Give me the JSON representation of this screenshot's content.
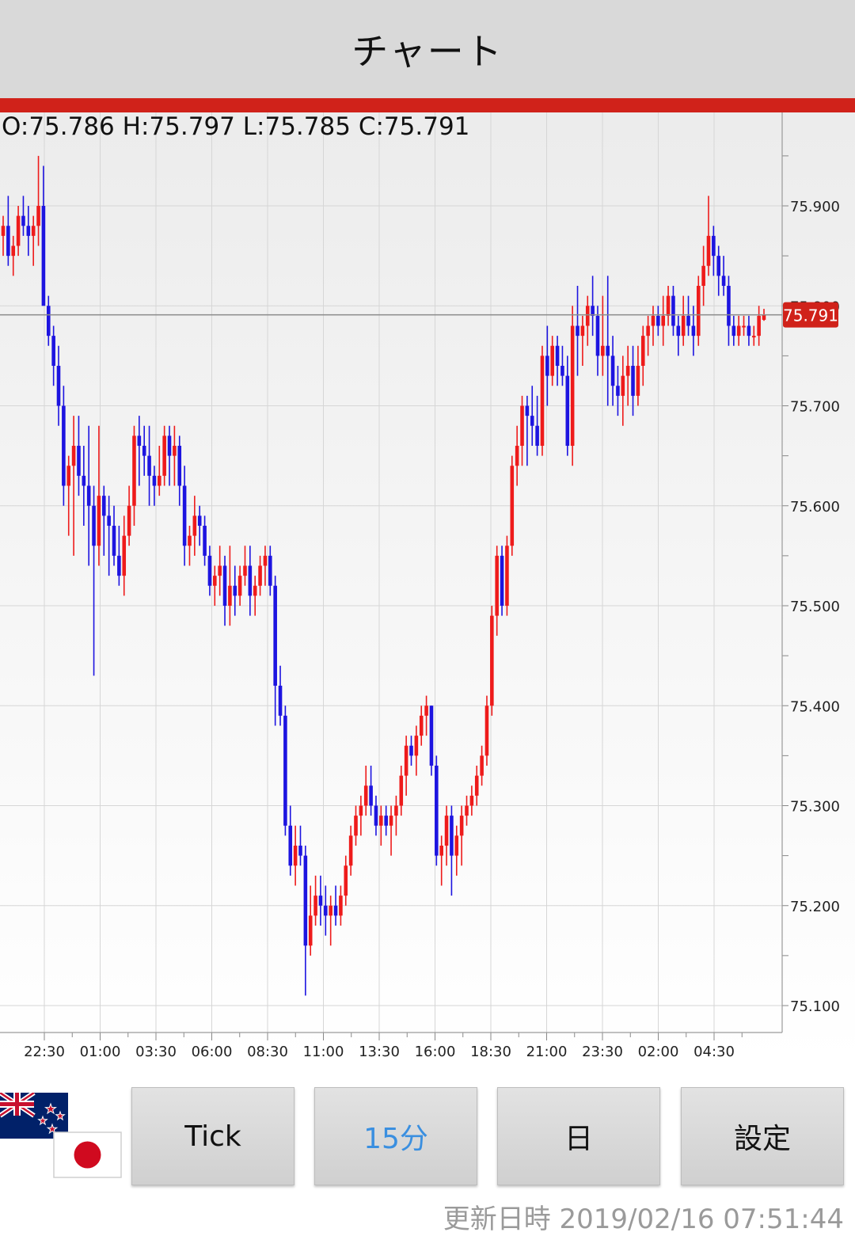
{
  "header": {
    "title": "チャート"
  },
  "ohlc": {
    "open_label": "O:",
    "open": "75.786",
    "high_label": "H:",
    "high": "75.797",
    "low_label": "L:",
    "low": "75.785",
    "close_label": "C:",
    "close": "75.791"
  },
  "colors": {
    "up": "#ee1b1b",
    "down": "#1d14e0",
    "accent": "#d0221a",
    "active_tab": "#3a8fe0"
  },
  "buttons": {
    "tick": "Tick",
    "min15": "15分",
    "day": "日",
    "settings": "設定"
  },
  "active_button": "min15",
  "flags": {
    "base": "new-zealand-flag-icon",
    "quote": "japan-flag-icon"
  },
  "status": {
    "updated_label": "更新日時",
    "updated_value": "2019/02/16 07:51:44"
  },
  "chart_data": {
    "type": "candlestick",
    "interval": "15分",
    "ylim": [
      75.08,
      75.99
    ],
    "y_ticks": [
      "75.900",
      "75.800",
      "75.700",
      "75.600",
      "75.500",
      "75.400",
      "75.300",
      "75.200",
      "75.100"
    ],
    "x_ticks": [
      "22:30",
      "01:00",
      "03:30",
      "06:00",
      "08:30",
      "11:00",
      "13:30",
      "16:00",
      "18:30",
      "21:00",
      "23:30",
      "02:00",
      "04:30"
    ],
    "current_price": "75.791",
    "grid": true,
    "series": [
      [
        75.87,
        75.89,
        75.85,
        75.88
      ],
      [
        75.88,
        75.91,
        75.84,
        75.85
      ],
      [
        75.85,
        75.87,
        75.83,
        75.86
      ],
      [
        75.86,
        75.9,
        75.85,
        75.89
      ],
      [
        75.89,
        75.91,
        75.87,
        75.88
      ],
      [
        75.88,
        75.9,
        75.85,
        75.87
      ],
      [
        75.87,
        75.89,
        75.84,
        75.88
      ],
      [
        75.88,
        75.95,
        75.86,
        75.9
      ],
      [
        75.9,
        75.94,
        75.86,
        75.8
      ],
      [
        75.8,
        75.81,
        75.76,
        75.77
      ],
      [
        75.77,
        75.78,
        75.72,
        75.74
      ],
      [
        75.74,
        75.76,
        75.68,
        75.7
      ],
      [
        75.7,
        75.72,
        75.6,
        75.62
      ],
      [
        75.62,
        75.65,
        75.57,
        75.64
      ],
      [
        75.64,
        75.69,
        75.55,
        75.66
      ],
      [
        75.66,
        75.69,
        75.61,
        75.63
      ],
      [
        75.63,
        75.66,
        75.58,
        75.62
      ],
      [
        75.62,
        75.68,
        75.54,
        75.6
      ],
      [
        75.6,
        75.62,
        75.43,
        75.56
      ],
      [
        75.56,
        75.68,
        75.54,
        75.61
      ],
      [
        75.61,
        75.62,
        75.55,
        75.59
      ],
      [
        75.59,
        75.61,
        75.53,
        75.58
      ],
      [
        75.58,
        75.6,
        75.54,
        75.55
      ],
      [
        75.55,
        75.58,
        75.52,
        75.53
      ],
      [
        75.53,
        75.59,
        75.51,
        75.57
      ],
      [
        75.57,
        75.62,
        75.56,
        75.6
      ],
      [
        75.6,
        75.68,
        75.58,
        75.67
      ],
      [
        75.67,
        75.69,
        75.62,
        75.66
      ],
      [
        75.66,
        75.68,
        75.63,
        75.65
      ],
      [
        75.65,
        75.68,
        75.6,
        75.63
      ],
      [
        75.63,
        75.64,
        75.6,
        75.62
      ],
      [
        75.62,
        75.66,
        75.61,
        75.63
      ],
      [
        75.63,
        75.68,
        75.62,
        75.67
      ],
      [
        75.67,
        75.68,
        75.62,
        75.65
      ],
      [
        75.65,
        75.68,
        75.62,
        75.66
      ],
      [
        75.66,
        75.67,
        75.6,
        75.62
      ],
      [
        75.62,
        75.64,
        75.54,
        75.56
      ],
      [
        75.56,
        75.58,
        75.54,
        75.57
      ],
      [
        75.57,
        75.61,
        75.55,
        75.59
      ],
      [
        75.59,
        75.6,
        75.56,
        75.58
      ],
      [
        75.58,
        75.59,
        75.54,
        75.55
      ],
      [
        75.55,
        75.56,
        75.51,
        75.52
      ],
      [
        75.52,
        75.54,
        75.5,
        75.53
      ],
      [
        75.53,
        75.56,
        75.51,
        75.54
      ],
      [
        75.54,
        75.55,
        75.48,
        75.5
      ],
      [
        75.5,
        75.56,
        75.48,
        75.52
      ],
      [
        75.52,
        75.54,
        75.49,
        75.51
      ],
      [
        75.51,
        75.54,
        75.5,
        75.53
      ],
      [
        75.53,
        75.56,
        75.52,
        75.54
      ],
      [
        75.54,
        75.56,
        75.49,
        75.51
      ],
      [
        75.51,
        75.53,
        75.49,
        75.52
      ],
      [
        75.52,
        75.55,
        75.51,
        75.54
      ],
      [
        75.54,
        75.56,
        75.52,
        75.55
      ],
      [
        75.55,
        75.56,
        75.51,
        75.52
      ],
      [
        75.52,
        75.53,
        75.38,
        75.42
      ],
      [
        75.42,
        75.44,
        75.38,
        75.39
      ],
      [
        75.39,
        75.4,
        75.27,
        75.28
      ],
      [
        75.28,
        75.3,
        75.23,
        75.24
      ],
      [
        75.24,
        75.28,
        75.22,
        75.26
      ],
      [
        75.26,
        75.28,
        75.24,
        75.25
      ],
      [
        75.25,
        75.26,
        75.11,
        75.16
      ],
      [
        75.16,
        75.22,
        75.15,
        75.19
      ],
      [
        75.19,
        75.23,
        75.18,
        75.21
      ],
      [
        75.21,
        75.23,
        75.18,
        75.2
      ],
      [
        75.2,
        75.22,
        75.17,
        75.19
      ],
      [
        75.19,
        75.21,
        75.16,
        75.2
      ],
      [
        75.2,
        75.22,
        75.18,
        75.19
      ],
      [
        75.19,
        75.22,
        75.18,
        75.21
      ],
      [
        75.21,
        75.25,
        75.2,
        75.24
      ],
      [
        75.24,
        75.28,
        75.23,
        75.27
      ],
      [
        75.27,
        75.3,
        75.26,
        75.29
      ],
      [
        75.29,
        75.31,
        75.27,
        75.3
      ],
      [
        75.3,
        75.34,
        75.29,
        75.32
      ],
      [
        75.32,
        75.34,
        75.29,
        75.3
      ],
      [
        75.3,
        75.31,
        75.27,
        75.28
      ],
      [
        75.28,
        75.3,
        75.26,
        75.29
      ],
      [
        75.29,
        75.3,
        75.27,
        75.28
      ],
      [
        75.28,
        75.3,
        75.25,
        75.29
      ],
      [
        75.29,
        75.31,
        75.27,
        75.3
      ],
      [
        75.3,
        75.34,
        75.29,
        75.33
      ],
      [
        75.33,
        75.37,
        75.31,
        75.36
      ],
      [
        75.36,
        75.37,
        75.34,
        75.35
      ],
      [
        75.35,
        75.38,
        75.33,
        75.37
      ],
      [
        75.37,
        75.4,
        75.36,
        75.39
      ],
      [
        75.39,
        75.41,
        75.37,
        75.4
      ],
      [
        75.4,
        75.4,
        75.33,
        75.34
      ],
      [
        75.34,
        75.35,
        75.24,
        75.25
      ],
      [
        75.25,
        75.27,
        75.22,
        75.26
      ],
      [
        75.26,
        75.3,
        75.24,
        75.29
      ],
      [
        75.29,
        75.3,
        75.21,
        75.25
      ],
      [
        75.25,
        75.28,
        75.23,
        75.27
      ],
      [
        75.27,
        75.3,
        75.24,
        75.29
      ],
      [
        75.29,
        75.31,
        75.28,
        75.3
      ],
      [
        75.3,
        75.32,
        75.29,
        75.31
      ],
      [
        75.31,
        75.34,
        75.3,
        75.33
      ],
      [
        75.33,
        75.36,
        75.32,
        75.35
      ],
      [
        75.35,
        75.41,
        75.34,
        75.4
      ],
      [
        75.4,
        75.5,
        75.39,
        75.49
      ],
      [
        75.49,
        75.56,
        75.47,
        75.55
      ],
      [
        75.55,
        75.56,
        75.49,
        75.5
      ],
      [
        75.5,
        75.57,
        75.49,
        75.56
      ],
      [
        75.56,
        75.65,
        75.55,
        75.64
      ],
      [
        75.64,
        75.68,
        75.62,
        75.66
      ],
      [
        75.66,
        75.71,
        75.64,
        75.7
      ],
      [
        75.7,
        75.71,
        75.64,
        75.69
      ],
      [
        75.69,
        75.72,
        75.66,
        75.68
      ],
      [
        75.68,
        75.71,
        75.65,
        75.66
      ],
      [
        75.66,
        75.76,
        75.65,
        75.75
      ],
      [
        75.75,
        75.78,
        75.7,
        75.73
      ],
      [
        75.73,
        75.77,
        75.72,
        75.76
      ],
      [
        75.76,
        75.77,
        75.72,
        75.74
      ],
      [
        75.74,
        75.76,
        75.72,
        75.73
      ],
      [
        75.73,
        75.75,
        75.65,
        75.66
      ],
      [
        75.66,
        75.8,
        75.64,
        75.78
      ],
      [
        75.78,
        75.82,
        75.73,
        75.77
      ],
      [
        75.77,
        75.79,
        75.74,
        75.78
      ],
      [
        75.78,
        75.81,
        75.76,
        75.8
      ],
      [
        75.8,
        75.83,
        75.77,
        75.79
      ],
      [
        75.79,
        75.8,
        75.73,
        75.75
      ],
      [
        75.75,
        75.81,
        75.73,
        75.76
      ],
      [
        75.76,
        75.83,
        75.7,
        75.75
      ],
      [
        75.75,
        75.77,
        75.7,
        75.72
      ],
      [
        75.72,
        75.74,
        75.69,
        75.71
      ],
      [
        75.71,
        75.75,
        75.68,
        75.73
      ],
      [
        75.73,
        75.76,
        75.7,
        75.74
      ],
      [
        75.74,
        75.76,
        75.69,
        75.71
      ],
      [
        75.71,
        75.76,
        75.7,
        75.74
      ],
      [
        75.74,
        75.78,
        75.72,
        75.77
      ],
      [
        75.77,
        75.79,
        75.75,
        75.78
      ],
      [
        75.78,
        75.8,
        75.76,
        75.79
      ],
      [
        75.79,
        75.8,
        75.77,
        75.78
      ],
      [
        75.78,
        75.81,
        75.76,
        75.79
      ],
      [
        75.79,
        75.82,
        75.78,
        75.81
      ],
      [
        75.81,
        75.82,
        75.77,
        75.78
      ],
      [
        75.78,
        75.79,
        75.75,
        75.77
      ],
      [
        75.77,
        75.81,
        75.76,
        75.79
      ],
      [
        75.79,
        75.81,
        75.77,
        75.78
      ],
      [
        75.78,
        75.8,
        75.75,
        75.77
      ],
      [
        75.77,
        75.83,
        75.76,
        75.82
      ],
      [
        75.82,
        75.86,
        75.8,
        75.84
      ],
      [
        75.84,
        75.91,
        75.83,
        75.87
      ],
      [
        75.87,
        75.88,
        75.83,
        75.85
      ],
      [
        75.85,
        75.86,
        75.81,
        75.83
      ],
      [
        75.83,
        75.85,
        75.81,
        75.82
      ],
      [
        75.82,
        75.83,
        75.76,
        75.78
      ],
      [
        75.78,
        75.79,
        75.76,
        75.77
      ],
      [
        75.77,
        75.79,
        75.76,
        75.78
      ],
      [
        75.78,
        75.79,
        75.77,
        75.78
      ],
      [
        75.78,
        75.79,
        75.76,
        75.77
      ],
      [
        75.77,
        75.78,
        75.76,
        75.77
      ],
      [
        75.77,
        75.8,
        75.76,
        75.79
      ],
      [
        75.786,
        75.797,
        75.785,
        75.791
      ]
    ]
  }
}
